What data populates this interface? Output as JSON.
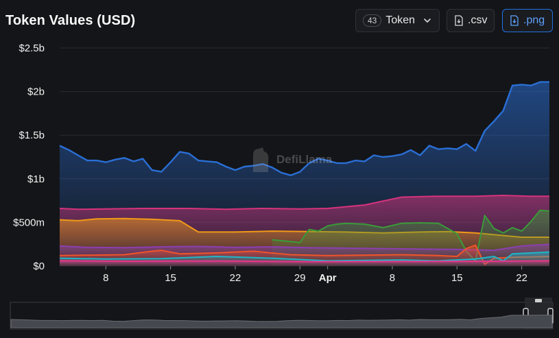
{
  "header": {
    "title": "Token Values (USD)",
    "token_count": "43",
    "token_label": "Token",
    "csv_label": ".csv",
    "png_label": ".png"
  },
  "watermark": "DefiLlama",
  "colors": {
    "background": "#141518",
    "accent": "#2172e5"
  },
  "chart_data": {
    "type": "area",
    "title": "Token Values (USD)",
    "y_ticks": [
      "$0",
      "$500m",
      "$1b",
      "$1.5b",
      "$2b",
      "$2.5b"
    ],
    "ylim": [
      0,
      2500000000
    ],
    "x_ticks": [
      {
        "label": "8",
        "day": 8,
        "bold": false
      },
      {
        "label": "15",
        "day": 15,
        "bold": false
      },
      {
        "label": "22",
        "day": 22,
        "bold": false
      },
      {
        "label": "29",
        "day": 29,
        "bold": false
      },
      {
        "label": "Apr",
        "day": 32,
        "bold": true
      },
      {
        "label": "8",
        "day": 39,
        "bold": false
      },
      {
        "label": "15",
        "day": 46,
        "bold": false
      },
      {
        "label": "22",
        "day": 53,
        "bold": false
      }
    ],
    "xlim": [
      3,
      56
    ],
    "grid": true,
    "series": [
      {
        "color": "#2a6fd6",
        "x": [
          3,
          4,
          5,
          6,
          7,
          8,
          9,
          10,
          11,
          12,
          13,
          14,
          15,
          16,
          17,
          18,
          19,
          20,
          21,
          22,
          23,
          24,
          25,
          26,
          27,
          28,
          29,
          30,
          31,
          32,
          33,
          34,
          35,
          36,
          37,
          38,
          39,
          40,
          41,
          42,
          43,
          44,
          45,
          46,
          47,
          48,
          49,
          50,
          51,
          52,
          53,
          54,
          55,
          56
        ],
        "values": [
          1380,
          1330,
          1270,
          1210,
          1210,
          1190,
          1220,
          1240,
          1200,
          1230,
          1100,
          1080,
          1190,
          1310,
          1290,
          1210,
          1200,
          1190,
          1140,
          1100,
          1140,
          1150,
          1170,
          1130,
          1070,
          1040,
          1080,
          1180,
          1230,
          1210,
          1180,
          1180,
          1210,
          1200,
          1270,
          1250,
          1260,
          1280,
          1330,
          1270,
          1380,
          1340,
          1350,
          1340,
          1400,
          1320,
          1550,
          1660,
          1780,
          2070,
          2080,
          2070,
          2110,
          2110
        ]
      },
      {
        "color": "#d7337c",
        "x": [
          3,
          5,
          8,
          12,
          17,
          21,
          25,
          29,
          32,
          36,
          40,
          44,
          48,
          51,
          54,
          56
        ],
        "values": [
          660,
          650,
          655,
          660,
          660,
          650,
          660,
          655,
          660,
          700,
          790,
          800,
          800,
          810,
          800,
          800
        ]
      },
      {
        "color": "#f09a17",
        "x": [
          3,
          5,
          7,
          10,
          13,
          16,
          18,
          22,
          26,
          30,
          34,
          38,
          42,
          45,
          48,
          51,
          53,
          56
        ],
        "values": [
          530,
          520,
          540,
          545,
          535,
          520,
          390,
          390,
          400,
          395,
          390,
          380,
          390,
          395,
          380,
          350,
          330,
          330
        ]
      },
      {
        "color": "#3b9b3a",
        "x": [
          26,
          28,
          29,
          30,
          31,
          32,
          33,
          34,
          36,
          38,
          40,
          42,
          44,
          45,
          46,
          47,
          48,
          49,
          50,
          51,
          52,
          53,
          54,
          55,
          56
        ],
        "values": [
          300,
          280,
          270,
          420,
          400,
          460,
          480,
          490,
          480,
          440,
          490,
          495,
          490,
          430,
          370,
          170,
          60,
          580,
          430,
          380,
          440,
          400,
          510,
          640,
          630
        ]
      },
      {
        "color": "#8c3fb0",
        "x": [
          3,
          6,
          10,
          14,
          18,
          22,
          26,
          30,
          34,
          38,
          42,
          46,
          50,
          53,
          56
        ],
        "values": [
          230,
          215,
          210,
          220,
          225,
          215,
          220,
          210,
          205,
          200,
          195,
          190,
          180,
          230,
          250
        ]
      },
      {
        "color": "#f0542a",
        "x": [
          3,
          10,
          13,
          14,
          16,
          20,
          24,
          28,
          32,
          36,
          40,
          44,
          46,
          47,
          48,
          49,
          50,
          52,
          56
        ],
        "values": [
          120,
          130,
          170,
          180,
          140,
          150,
          170,
          130,
          120,
          125,
          130,
          120,
          110,
          200,
          240,
          20,
          90,
          100,
          110
        ]
      },
      {
        "color": "#1fb6c8",
        "x": [
          3,
          8,
          14,
          20,
          26,
          30,
          32,
          36,
          40,
          44,
          48,
          50,
          51,
          52,
          56
        ],
        "values": [
          90,
          80,
          85,
          110,
          90,
          70,
          60,
          65,
          70,
          60,
          80,
          110,
          60,
          140,
          160
        ]
      },
      {
        "color": "#e8368b",
        "x": [
          3,
          10,
          20,
          30,
          40,
          50,
          56
        ],
        "values": [
          60,
          55,
          58,
          50,
          52,
          55,
          60
        ]
      }
    ]
  }
}
